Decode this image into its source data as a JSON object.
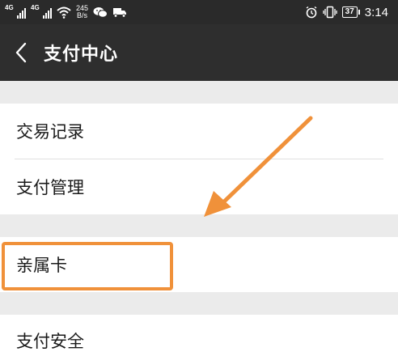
{
  "status_bar": {
    "sim1": "4G",
    "sim2": "4G",
    "net_speed": "245",
    "net_unit": "B/s",
    "battery": "37",
    "time": "3:14",
    "icons": [
      "wechat-icon",
      "truck-icon",
      "alarm-icon",
      "vibrate-icon"
    ]
  },
  "header": {
    "title": "支付中心",
    "back_icon": "chevron-left-icon"
  },
  "menu": {
    "groups": [
      {
        "items": [
          {
            "label": "交易记录"
          },
          {
            "label": "支付管理"
          }
        ]
      },
      {
        "items": [
          {
            "label": "亲属卡"
          }
        ]
      },
      {
        "items": [
          {
            "label": "支付安全"
          }
        ]
      }
    ]
  },
  "annotation": {
    "color": "#f0913a",
    "target": "亲属卡"
  }
}
